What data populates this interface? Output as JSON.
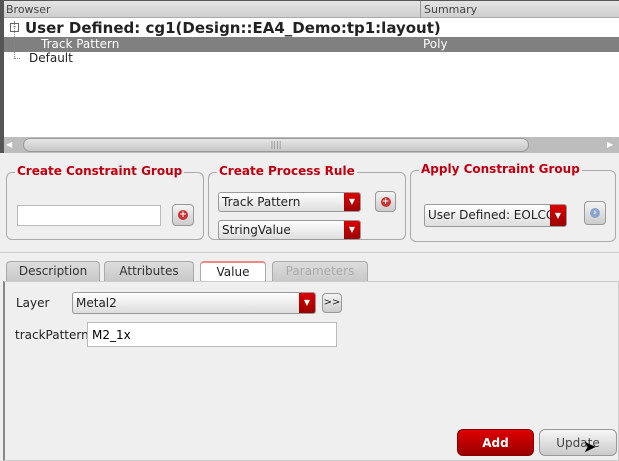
{
  "browser": {
    "col_browser": "Browser",
    "col_summary": "Summary",
    "rows": [
      {
        "label": "User Defined: cg1(Design::EA4_Demo:tp1:layout)",
        "summary": ""
      },
      {
        "label": "Track Pattern",
        "summary": "Poly"
      },
      {
        "label": "Default",
        "summary": ""
      }
    ],
    "scroll_grip": "||||"
  },
  "create_group": {
    "title": "Create Constraint Group",
    "input_value": ""
  },
  "process_rule": {
    "title": "Create Process Rule",
    "rule": "Track Pattern",
    "value_type": "StringValue"
  },
  "apply_group": {
    "title": "Apply Constraint Group",
    "selected": "User Defined: EOLCGroup"
  },
  "tabs": [
    {
      "label": "Description"
    },
    {
      "label": "Attributes"
    },
    {
      "label": "Value"
    },
    {
      "label": "Parameters"
    }
  ],
  "value": {
    "layer_label": "Layer",
    "layer": "Metal2",
    "more": ">>",
    "track_label": "trackPattern",
    "track_value": "M2_1x"
  },
  "buttons": {
    "add": "Add",
    "update": "Update"
  },
  "colors": {
    "accent": "#c00010",
    "selected_row": "#808080"
  }
}
